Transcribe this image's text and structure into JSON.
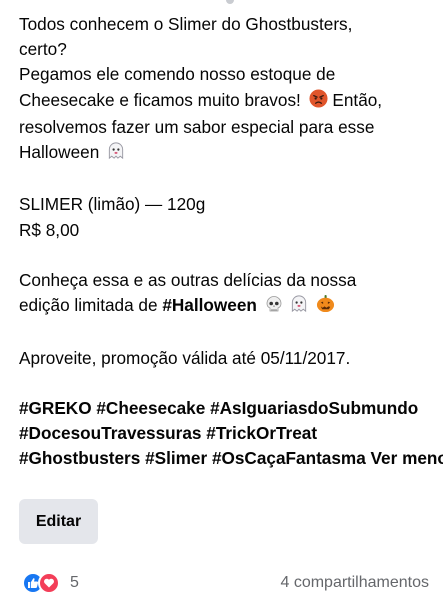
{
  "post": {
    "line1": "Todos conhecem o Slimer do Ghostbusters,",
    "line2": "certo?",
    "line3": "Pegamos ele comendo nosso estoque de",
    "line4": "Cheesecake e ficamos muito bravos!",
    "line4_after": "Então,",
    "line5": "resolvemos fazer um sabor especial para esse",
    "line6": "Halloween",
    "product_line": "SLIMER (limão) — 120g",
    "price_line": "R$ 8,00",
    "promo_line1": "Conheça essa e as outras delícias da nossa",
    "promo_line2_prefix": "edição limitada de",
    "promo_line2_tag": "#Halloween",
    "validity_line": "Aproveite, promoção válida até 05/11/2017.",
    "hashtags_line1": "#GREKO #Cheesecake #AsIguariasdoSubmundo",
    "hashtags_line2": "#DocesouTravessuras #TrickOrTreat",
    "hashtags_line3": "#Ghostbusters #Slimer #OsCaçaFantasma",
    "see_less": "Ver menos"
  },
  "icons": {
    "angry": "angry-face-icon",
    "ghost": "ghost-icon",
    "skull": "skull-icon",
    "pumpkin": "jack-o-lantern-icon",
    "like": "like-icon",
    "love": "love-icon"
  },
  "actions": {
    "edit_label": "Editar"
  },
  "footer": {
    "reaction_count": "5",
    "shares": "4 compartilhamentos"
  },
  "colors": {
    "like": "#1877f2",
    "love": "#f33e58",
    "button_bg": "#e4e6eb",
    "secondary_text": "#65676b"
  }
}
